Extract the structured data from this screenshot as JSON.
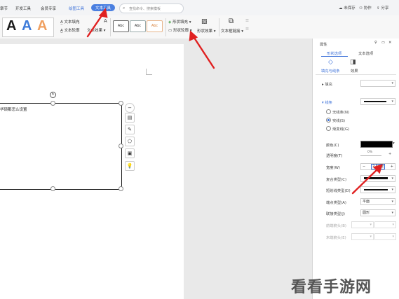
{
  "tabs": [
    "章节",
    "开发工具",
    "会员专享",
    "绘图工具",
    "文本工具"
  ],
  "search_placeholder": "查找命令、搜索模板",
  "top_right": {
    "sync": "未保存",
    "collab": "协作",
    "share": "分享"
  },
  "ribbon": {
    "text_fill": "文本填充",
    "text_outline": "文本轮廓",
    "text_effect": "文本效果",
    "style_samples": [
      "Abc",
      "Abc",
      "Abc"
    ],
    "shape_fill": "形状填充",
    "shape_outline": "形状轮廓",
    "shape_effect": "形状效果",
    "textbox_link": "文本框链接",
    "big_a_letters": [
      "A",
      "A",
      "A"
    ]
  },
  "document": {
    "shape_text": "华硕都怎么设置"
  },
  "panel": {
    "title": "属性",
    "tab_shape": "形状选项",
    "tab_text": "文本选项",
    "sub_fill_line": "填充与线条",
    "sub_effect": "效果",
    "fill_label": "填充",
    "line_label": "线条",
    "radio_no_line": "无线条(N)",
    "radio_solid": "实线(S)",
    "radio_gradient": "渐变线(G)",
    "color_label": "颜色(C)",
    "transparency_label": "透明度(T)",
    "transparency_value": "0%",
    "width_label": "宽度(W)",
    "width_value": "2.50磅",
    "compound_label": "复合类型(C)",
    "dash_label": "短划线类型(D)",
    "cap_label": "端点类型(A)",
    "cap_value": "平面",
    "join_label": "联接类型(J)",
    "join_value": "圆形",
    "begin_arrow": "前端箭头(B)",
    "end_arrow": "末端箭头(E)"
  },
  "watermark": "看看手游网",
  "colors": {
    "accent": "#4a7fe0",
    "annotation": "#e02020"
  }
}
